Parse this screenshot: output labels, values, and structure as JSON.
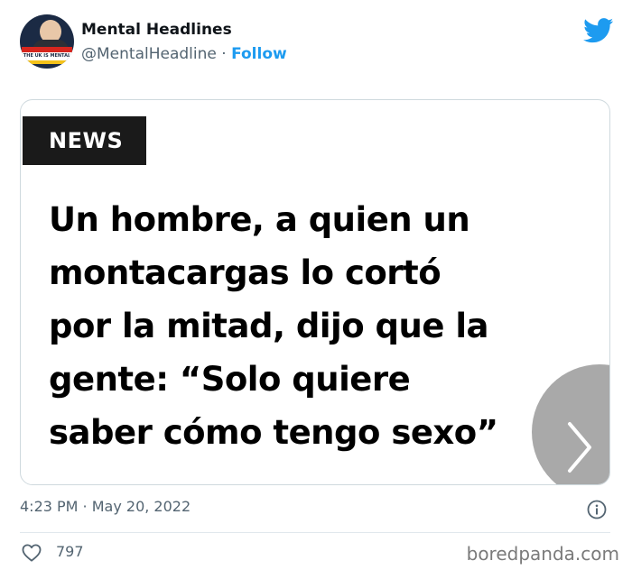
{
  "author": {
    "display_name": "Mental Headlines",
    "handle": "@MentalHeadline",
    "separator": "·",
    "follow_label": "Follow",
    "avatar_caption": "THE UK IS MENTAL"
  },
  "card": {
    "badge": "NEWS",
    "headline_lines": [
      "Un hombre, a quien un",
      "montacargas lo cortó",
      "por la mitad, dijo que la",
      "gente: “Solo quiere",
      "saber cómo tengo sexo”"
    ]
  },
  "meta": {
    "timestamp": "4:23 PM · May 20, 2022"
  },
  "stats": {
    "likes": "797"
  },
  "watermark": "boredpanda.com",
  "icons": {
    "brand": "twitter-bird-icon",
    "info": "info-icon",
    "like": "heart-icon",
    "next": "chevron-right-icon"
  },
  "colors": {
    "accent": "#1d9bf0",
    "muted": "#536471",
    "badge_bg": "#1a1a1a"
  }
}
